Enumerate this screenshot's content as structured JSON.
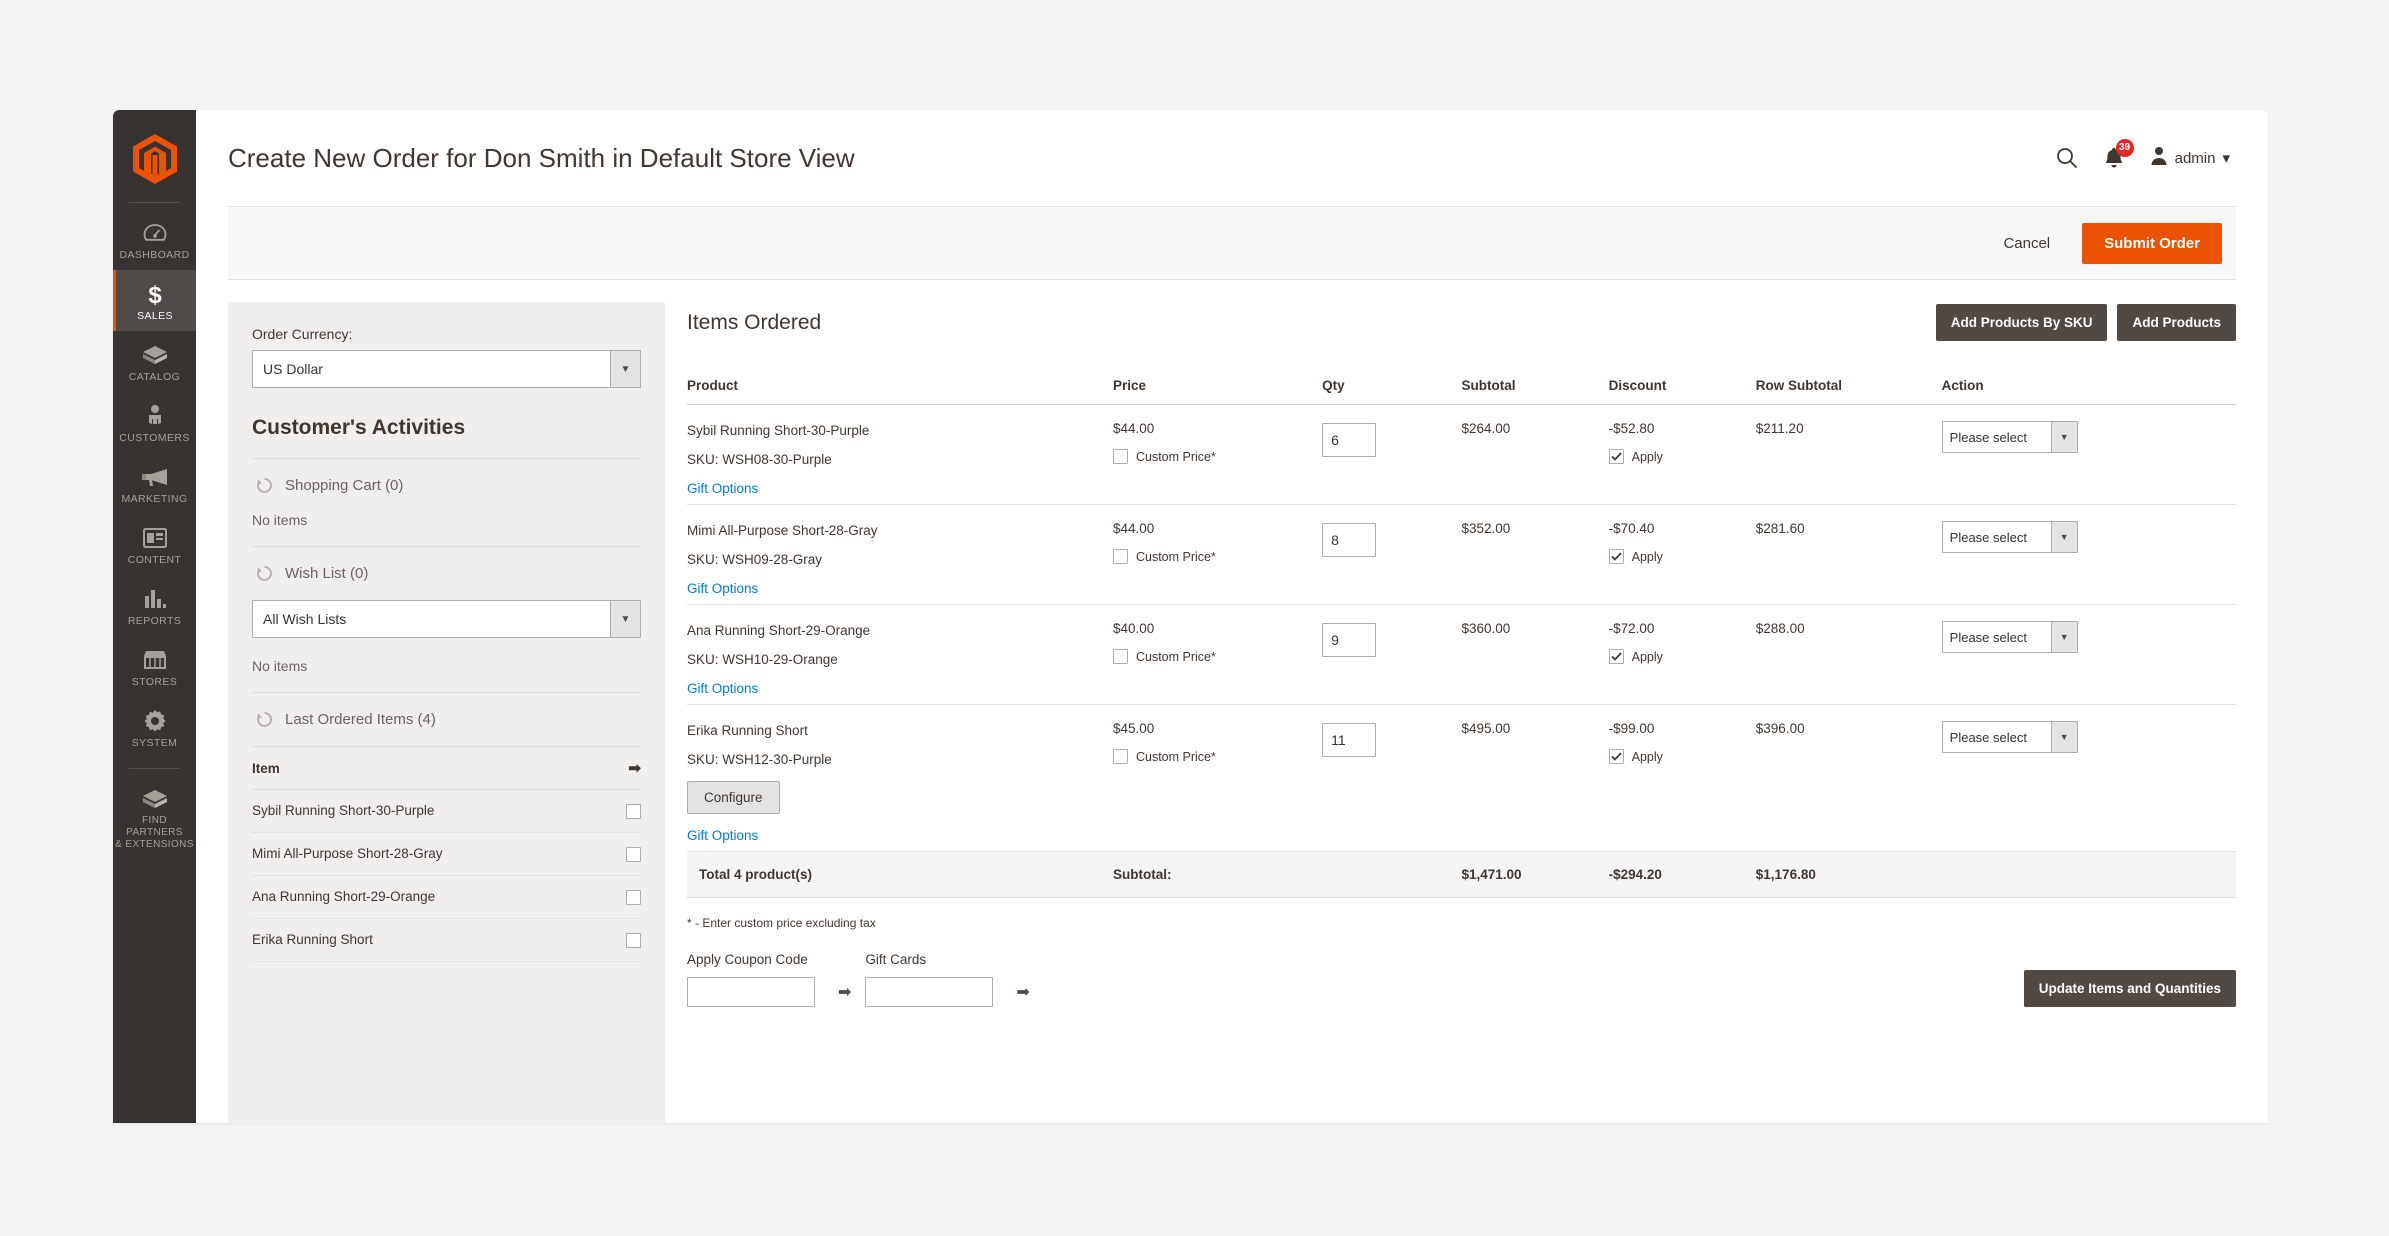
{
  "sidebar": {
    "logo_name": "magento-logo",
    "items": [
      {
        "label": "DASHBOARD",
        "icon": "dashboard-icon",
        "active": false
      },
      {
        "label": "SALES",
        "icon": "sales-dollar-icon",
        "active": true
      },
      {
        "label": "CATALOG",
        "icon": "catalog-box-icon",
        "active": false
      },
      {
        "label": "CUSTOMERS",
        "icon": "customers-person-icon",
        "active": false
      },
      {
        "label": "MARKETING",
        "icon": "marketing-megaphone-icon",
        "active": false
      },
      {
        "label": "CONTENT",
        "icon": "content-layout-icon",
        "active": false
      },
      {
        "label": "REPORTS",
        "icon": "reports-bar-chart-icon",
        "active": false
      },
      {
        "label": "STORES",
        "icon": "stores-shop-icon",
        "active": false
      },
      {
        "label": "SYSTEM",
        "icon": "system-gear-icon",
        "active": false
      },
      {
        "label": "FIND PARTNERS\n& EXTENSIONS",
        "icon": "partners-box-icon",
        "active": false
      }
    ]
  },
  "header": {
    "title": "Create New Order for Don Smith in Default Store View",
    "search_icon": "search-icon",
    "notifications_icon": "bell-icon",
    "notifications_count": "39",
    "user_icon": "user-avatar-icon",
    "user_name": "admin",
    "user_caret": "▾"
  },
  "action_strip": {
    "cancel_label": "Cancel",
    "submit_label": "Submit Order"
  },
  "left_panel": {
    "currency_label": "Order Currency:",
    "currency_value": "US Dollar",
    "activities_title": "Customer's Activities",
    "shopping_cart_label": "Shopping Cart (0)",
    "shopping_cart_empty": "No items",
    "wish_list_label": "Wish List (0)",
    "wish_list_select": "All Wish Lists",
    "wish_list_empty": "No items",
    "last_ordered_label": "Last Ordered Items (4)",
    "item_col_header": "Item",
    "last_ordered_items": [
      "Sybil Running Short-30-Purple",
      "Mimi All-Purpose Short-28-Gray",
      "Ana Running Short-29-Orange",
      "Erika Running Short"
    ]
  },
  "items_ordered": {
    "title": "Items Ordered",
    "add_by_sku_label": "Add Products By SKU",
    "add_products_label": "Add Products",
    "columns": [
      "Product",
      "Price",
      "Qty",
      "Subtotal",
      "Discount",
      "Row Subtotal",
      "Action"
    ],
    "custom_price_label": "Custom Price*",
    "apply_label": "Apply",
    "gift_options_label": "Gift Options",
    "configure_label": "Configure",
    "action_placeholder": "Please select",
    "rows": [
      {
        "name": "Sybil Running Short-30-Purple",
        "sku": "SKU: WSH08-30-Purple",
        "price": "$44.00",
        "qty": "6",
        "subtotal": "$264.00",
        "discount": "-$52.80",
        "row_subtotal": "$211.20",
        "has_configure": false
      },
      {
        "name": "Mimi All-Purpose Short-28-Gray",
        "sku": "SKU: WSH09-28-Gray",
        "price": "$44.00",
        "qty": "8",
        "subtotal": "$352.00",
        "discount": "-$70.40",
        "row_subtotal": "$281.60",
        "has_configure": false
      },
      {
        "name": "Ana Running Short-29-Orange",
        "sku": "SKU: WSH10-29-Orange",
        "price": "$40.00",
        "qty": "9",
        "subtotal": "$360.00",
        "discount": "-$72.00",
        "row_subtotal": "$288.00",
        "has_configure": false
      },
      {
        "name": "Erika Running Short",
        "sku": "SKU: WSH12-30-Purple",
        "price": "$45.00",
        "qty": "11",
        "subtotal": "$495.00",
        "discount": "-$99.00",
        "row_subtotal": "$396.00",
        "has_configure": true
      }
    ],
    "totals": {
      "count_label": "Total 4 product(s)",
      "subtotal_label": "Subtotal:",
      "subtotal": "$1,471.00",
      "discount": "-$294.20",
      "row_subtotal": "$1,176.80"
    },
    "note": "* - Enter custom price excluding tax"
  },
  "footer": {
    "coupon_label": "Apply Coupon Code",
    "coupon_value": "",
    "gift_cards_label": "Gift Cards",
    "gift_cards_value": "",
    "update_label": "Update Items and Quantities"
  },
  "colors": {
    "brand_orange": "#eb5202",
    "sidebar_dark": "#373330",
    "button_dark": "#514943",
    "link_blue": "#007bdb",
    "badge_red": "#e22626"
  }
}
